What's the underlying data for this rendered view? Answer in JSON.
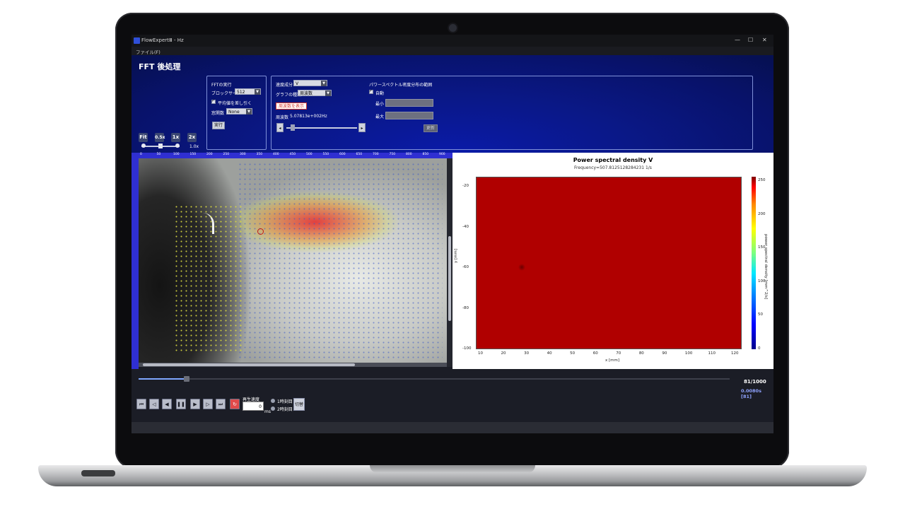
{
  "window": {
    "title": "FlowExpertⅢ - Hz",
    "controls": [
      "—",
      "☐",
      "✕"
    ]
  },
  "menu": {
    "file": "ファイル(F)"
  },
  "panel": {
    "heading": "FFT 後処理",
    "zoom": {
      "fit": "Fit",
      "z05": "0.5x",
      "z1": "1x",
      "z2": "2x",
      "level": "1.0x"
    },
    "fft_exec": {
      "title": "FFTの実行",
      "block_size_label": "ブロックサイズ",
      "block_size_value": "512",
      "subtract_mean_label": "平均値を差し引く",
      "subtract_mean_checked": true,
      "window_label": "窓関数",
      "window_value": "None",
      "run_label": "実行"
    },
    "velocity": {
      "component_label": "速度成分",
      "component_value": "V",
      "graph_type_label": "グラフの種類",
      "graph_type_value": "周波数",
      "show_freq_button": "周波数を表示",
      "freq_label": "周波数",
      "freq_value": "5.07813e+002Hz",
      "freq_slider_fraction": 0.06
    },
    "psd_range": {
      "title": "パワースペクトル密度分布の範囲",
      "auto_label": "自動",
      "auto_checked": true,
      "min_label": "最小",
      "max_label": "最大",
      "apply_label": "更新"
    }
  },
  "ruler": {
    "h_ticks": [
      "0",
      "50",
      "100",
      "150",
      "200",
      "250",
      "300",
      "350",
      "400",
      "450",
      "500",
      "550",
      "600",
      "650",
      "700",
      "750",
      "800",
      "850",
      "900"
    ]
  },
  "plot": {
    "title": "Power spectral density V",
    "subtitle": "Frequency=507.8125128284231 1/s",
    "xlabel": "x [mm]",
    "ylabel": "y [mm]",
    "cbar_label": "power spectral density [mm^2/s]",
    "xticks": [
      "10",
      "20",
      "30",
      "40",
      "50",
      "60",
      "70",
      "80",
      "90",
      "100",
      "110",
      "120"
    ],
    "yticks": [
      "-20",
      "-40",
      "-60",
      "-80",
      "-100"
    ],
    "cticks": [
      "250",
      "200",
      "150",
      "100",
      "50",
      "0"
    ]
  },
  "player": {
    "frame": "81/1000",
    "time": "0.0080s [81]",
    "progress_fraction": 0.081,
    "speed_label": "再生速度",
    "speed_value": "0",
    "speed_unit": "ms",
    "first_time": "1時刻目",
    "second_time": "2時刻目",
    "switch_label": "切替",
    "icons": [
      "first-icon",
      "prev-icon",
      "rewind-icon",
      "pause-icon",
      "play-icon",
      "forward-icon",
      "last-icon",
      "loop-icon"
    ]
  }
}
